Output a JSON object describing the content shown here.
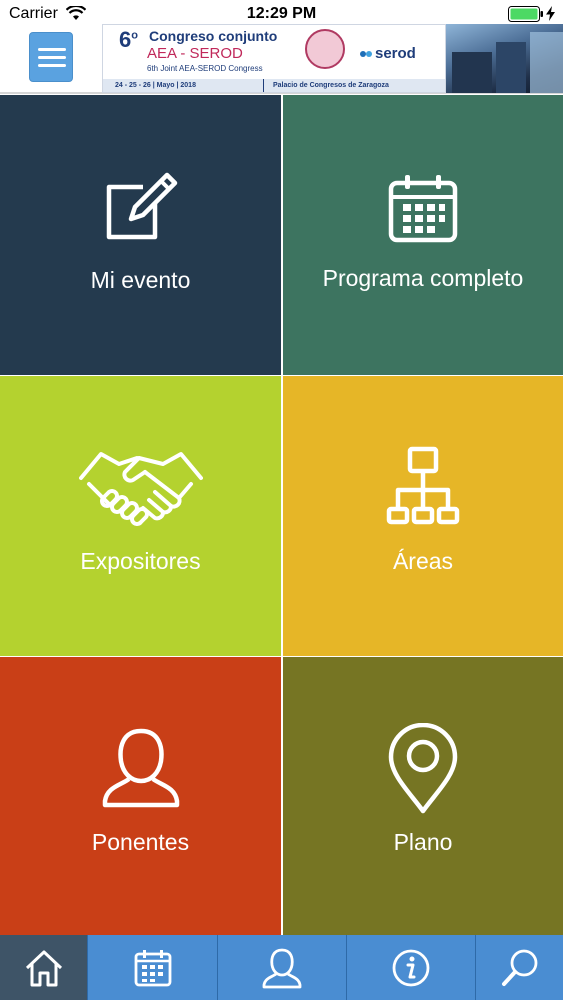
{
  "status_bar": {
    "carrier": "Carrier",
    "time": "12:29 PM"
  },
  "banner": {
    "edition": "6",
    "edition_suffix": "o",
    "title_line1": "Congreso conjunto",
    "title_line2": "AEA - SEROD",
    "subtitle": "6th Joint AEA-SEROD Congress",
    "partner": "serod",
    "dates": "24 - 25 - 26 | Mayo | 2018",
    "venue": "Palacio de Congresos de Zaragoza"
  },
  "tiles": [
    {
      "label": "Mi evento",
      "icon": "edit-icon",
      "color": "#243a4e"
    },
    {
      "label": "Programa completo",
      "icon": "calendar-icon",
      "color": "#3d7460"
    },
    {
      "label": "Expositores",
      "icon": "handshake-icon",
      "color": "#b4d22f"
    },
    {
      "label": "Áreas",
      "icon": "sitemap-icon",
      "color": "#e6b627"
    },
    {
      "label": "Ponentes",
      "icon": "user-icon",
      "color": "#c93f17"
    },
    {
      "label": "Plano",
      "icon": "map-pin-icon",
      "color": "#767523"
    }
  ],
  "tab_bar": {
    "tabs": [
      {
        "icon": "home-icon",
        "active": true
      },
      {
        "icon": "calendar-icon",
        "active": false
      },
      {
        "icon": "user-icon",
        "active": false
      },
      {
        "icon": "info-icon",
        "active": false
      },
      {
        "icon": "search-icon",
        "active": false
      }
    ],
    "colors": {
      "bar": "#4a8dd2",
      "active": "#3e5467"
    }
  }
}
